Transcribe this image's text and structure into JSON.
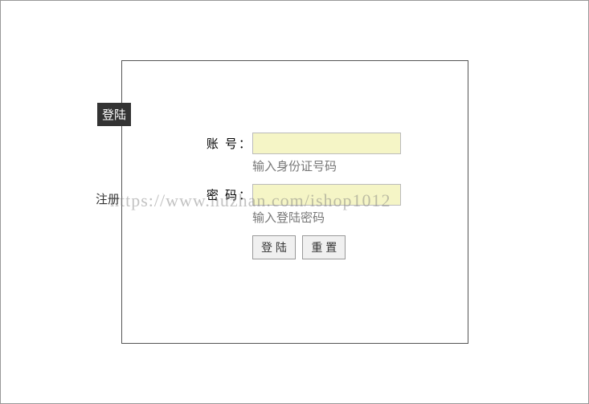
{
  "tabs": {
    "login": "登陆",
    "register": "注册"
  },
  "form": {
    "account": {
      "label": "账 号：",
      "value": "",
      "hint": "输入身份证号码"
    },
    "password": {
      "label": "密 码：",
      "value": "",
      "hint": "输入登陆密码"
    }
  },
  "buttons": {
    "submit": "登 陆",
    "reset": "重 置"
  },
  "watermark": "https://www.huzhan.com/ishop1012"
}
